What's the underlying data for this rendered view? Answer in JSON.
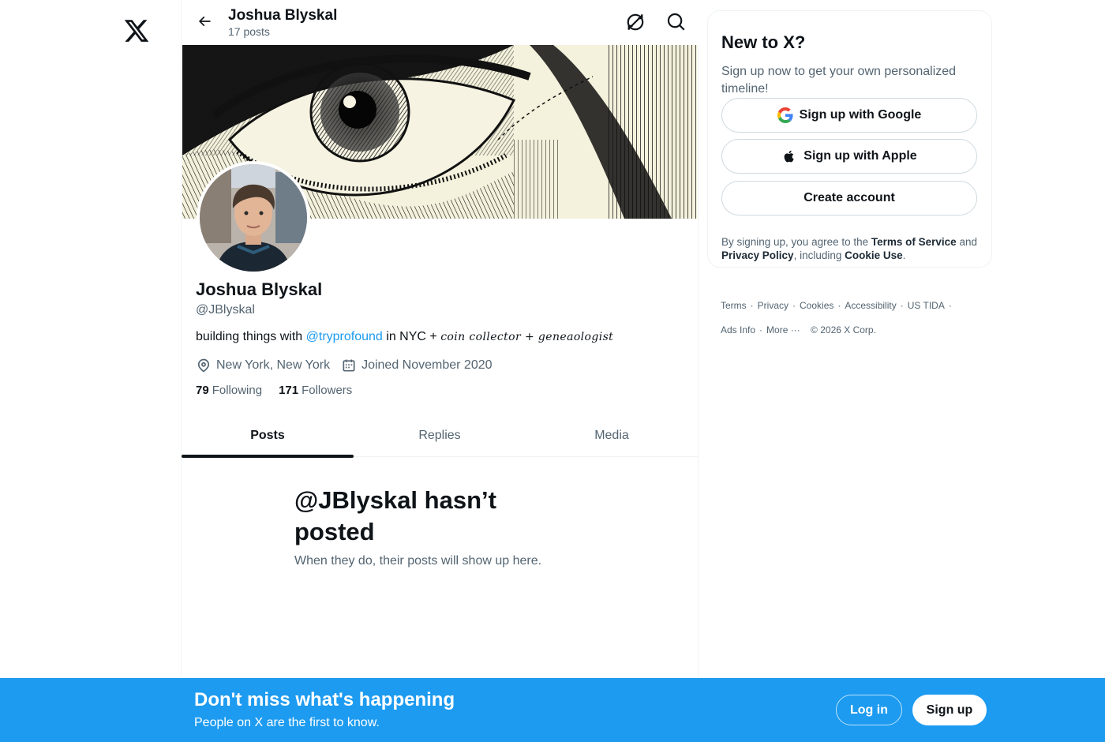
{
  "header": {
    "name": "Joshua Blyskal",
    "posts_count": "17 posts"
  },
  "icons": {
    "logo": "x-logo-icon",
    "back": "arrow-left-icon",
    "refresh": "refresh-icon",
    "search": "search-icon",
    "location": "location-pin-icon",
    "calendar": "calendar-icon",
    "google": "google-icon",
    "apple": "apple-icon"
  },
  "profile": {
    "display_name": "Joshua Blyskal",
    "handle": "@JBlyskal",
    "bio": {
      "prefix": "building things with ",
      "mention": "@tryprofound",
      "middle": " in NYC + ",
      "stylized": "coin collector + geneaologist"
    },
    "location": "New York, New York",
    "joined": "Joined November 2020",
    "following_count": "79",
    "following_label": "Following",
    "followers_count": "171",
    "followers_label": "Followers"
  },
  "tabs": [
    {
      "label": "Posts",
      "active": true
    },
    {
      "label": "Replies",
      "active": false
    },
    {
      "label": "Media",
      "active": false
    }
  ],
  "empty_state": {
    "title": "@JBlyskal hasn’t posted",
    "subtitle": "When they do, their posts will show up here."
  },
  "signup_card": {
    "title": "New to X?",
    "subtitle": "Sign up now to get your own personalized timeline!",
    "google_label": "Sign up with Google",
    "apple_label": "Sign up with Apple",
    "create_label": "Create account",
    "legal_prefix": "By signing up, you agree to the ",
    "terms_link": "Terms of Service",
    "legal_and": " and ",
    "privacy_link": "Privacy Policy",
    "legal_including": ", including ",
    "cookie_link": "Cookie Use",
    "legal_end": "."
  },
  "footer": {
    "links": [
      "Terms",
      "Privacy",
      "Cookies",
      "Accessibility",
      "US TIDA",
      "Ads Info",
      "More ···"
    ],
    "copyright": "© 2026 X Corp."
  },
  "bottom_bar": {
    "title": "Don't miss what's happening",
    "subtitle": "People on X are the first to know.",
    "login_label": "Log in",
    "signup_label": "Sign up"
  },
  "colors": {
    "accent": "#1d9bf0",
    "text": "#0f1419",
    "secondary": "#536471",
    "border": "#cfd9de"
  }
}
